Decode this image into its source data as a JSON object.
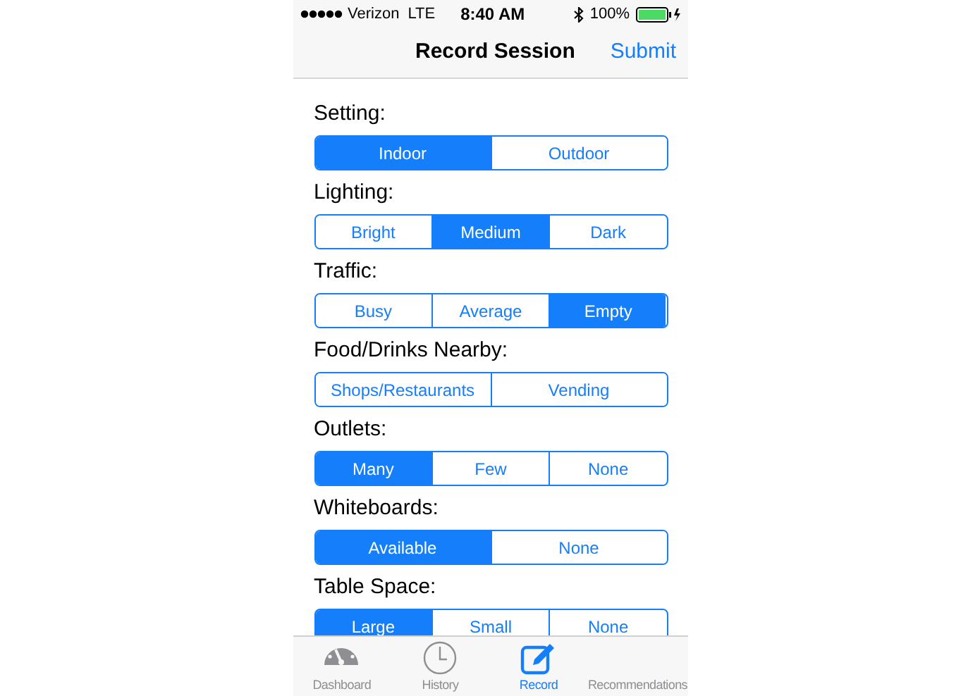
{
  "status_bar": {
    "carrier": "Verizon",
    "network": "LTE",
    "time": "8:40 AM",
    "battery": "100%"
  },
  "nav_bar": {
    "title": "Record Session",
    "action": "Submit"
  },
  "sections": [
    {
      "label": "Setting:",
      "options": [
        {
          "label": "Indoor",
          "selected": true
        },
        {
          "label": "Outdoor",
          "selected": false
        }
      ]
    },
    {
      "label": "Lighting:",
      "options": [
        {
          "label": "Bright",
          "selected": false
        },
        {
          "label": "Medium",
          "selected": true
        },
        {
          "label": "Dark",
          "selected": false
        }
      ]
    },
    {
      "label": "Traffic:",
      "options": [
        {
          "label": "Busy",
          "selected": false
        },
        {
          "label": "Average",
          "selected": false
        },
        {
          "label": "Empty",
          "selected": true
        }
      ]
    },
    {
      "label": "Food/Drinks Nearby:",
      "options": [
        {
          "label": "Shops/Restaurants",
          "selected": false
        },
        {
          "label": "Vending",
          "selected": false
        }
      ]
    },
    {
      "label": "Outlets:",
      "options": [
        {
          "label": "Many",
          "selected": true
        },
        {
          "label": "Few",
          "selected": false
        },
        {
          "label": "None",
          "selected": false
        }
      ]
    },
    {
      "label": "Whiteboards:",
      "options": [
        {
          "label": "Available",
          "selected": true
        },
        {
          "label": "None",
          "selected": false
        }
      ]
    },
    {
      "label": "Table Space:",
      "options": [
        {
          "label": "Large",
          "selected": true
        },
        {
          "label": "Small",
          "selected": false
        },
        {
          "label": "None",
          "selected": false
        }
      ]
    }
  ],
  "tab_bar": [
    {
      "label": "Dashboard",
      "kind": "dashboard",
      "selected": false
    },
    {
      "label": "History",
      "kind": "history",
      "selected": false
    },
    {
      "label": "Record",
      "kind": "record",
      "selected": true
    },
    {
      "label": "Recommendations",
      "kind": "recommendations",
      "selected": false
    }
  ]
}
